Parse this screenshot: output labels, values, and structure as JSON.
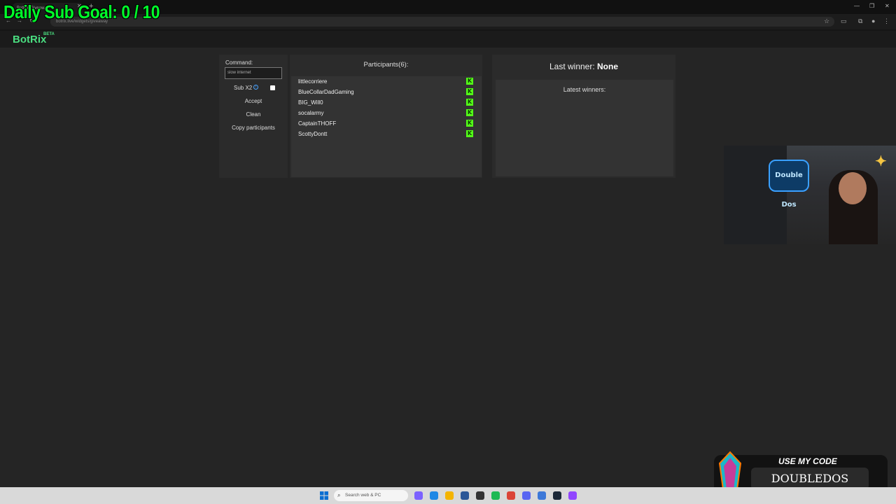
{
  "overlay": {
    "goal_text": "Daily Sub Goal:  0 / 10"
  },
  "browser": {
    "tab_title": "BotRix Giveaway",
    "url": "botrix.live/widgets/giveaway",
    "new_tab_glyph": "+",
    "close_glyph": "✕"
  },
  "app": {
    "logo": "BotRix",
    "beta": "BETA"
  },
  "command": {
    "label": "Command:",
    "value": "slow internet",
    "sub_label": "Sub X2",
    "sub_checked": false,
    "buttons": [
      "Accept",
      "Clean",
      "Copy participants"
    ]
  },
  "participants": {
    "title": "Participants(6):",
    "items": [
      "littlecorriere",
      "BlueCollarDadGaming",
      "BIG_Will0",
      "socalarmy",
      "CaptainTHOFF",
      "ScottyDontt"
    ],
    "platform_icon": "kick-icon",
    "platform_color": "#53fc18"
  },
  "winners": {
    "last_label": "Last winner:",
    "last_value": "None",
    "latest_title": "Latest winners:"
  },
  "webcam": {
    "logo_text": "Double Dos"
  },
  "code_overlay": {
    "label": "USE MY CODE",
    "code": "DOUBLEDOS"
  },
  "taskbar": {
    "search_placeholder": "Search web & PC"
  },
  "colors": {
    "accent": "#4ade80",
    "goal": "#00ff2a",
    "kick": "#53fc18",
    "code_border": "#ff7a00"
  }
}
